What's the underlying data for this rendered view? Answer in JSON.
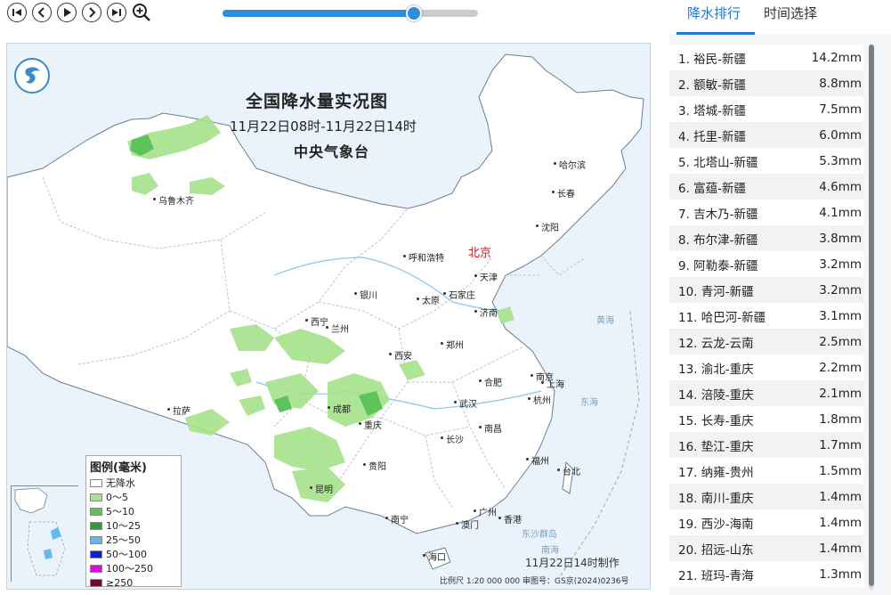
{
  "map": {
    "title": "全国降水量实况图",
    "subtitle": "11月22日08时-11月22日14时",
    "issuer": "中央气象台",
    "made_time": "11月22日14时制作",
    "footnote": "比例尺 1:20 000 000     审图号：GS京(2024)0236号",
    "capital": "北京",
    "cities": [
      {
        "name": "哈尔滨"
      },
      {
        "name": "长春"
      },
      {
        "name": "沈阳"
      },
      {
        "name": "乌鲁木齐"
      },
      {
        "name": "呼和浩特"
      },
      {
        "name": "天津"
      },
      {
        "name": "石家庄"
      },
      {
        "name": "太原"
      },
      {
        "name": "银川"
      },
      {
        "name": "济南"
      },
      {
        "name": "西宁"
      },
      {
        "name": "兰州"
      },
      {
        "name": "郑州"
      },
      {
        "name": "西安"
      },
      {
        "name": "南京"
      },
      {
        "name": "合肥"
      },
      {
        "name": "上海"
      },
      {
        "name": "杭州"
      },
      {
        "name": "武汉"
      },
      {
        "name": "成都"
      },
      {
        "name": "重庆"
      },
      {
        "name": "拉萨"
      },
      {
        "name": "南昌"
      },
      {
        "name": "长沙"
      },
      {
        "name": "福州"
      },
      {
        "name": "贵阳"
      },
      {
        "name": "台北"
      },
      {
        "name": "昆明"
      },
      {
        "name": "南宁"
      },
      {
        "name": "广州"
      },
      {
        "name": "香港"
      },
      {
        "name": "澳门"
      },
      {
        "name": "海口"
      }
    ],
    "seas": [
      {
        "name": "黄海"
      },
      {
        "name": "东海"
      },
      {
        "name": "南海"
      },
      {
        "name": "东沙群岛"
      }
    ],
    "legend": {
      "title": "图例(毫米)",
      "items": [
        {
          "label": "无降水",
          "color": "#ffffff"
        },
        {
          "label": "0～5",
          "color": "#a6e28a"
        },
        {
          "label": "5～10",
          "color": "#5cc45a"
        },
        {
          "label": "10～25",
          "color": "#2f9b3a"
        },
        {
          "label": "25～50",
          "color": "#62b8f0"
        },
        {
          "label": "50～100",
          "color": "#0a1fe0"
        },
        {
          "label": "100～250",
          "color": "#ea00ea"
        },
        {
          "label": "≥250",
          "color": "#7e0030"
        }
      ]
    }
  },
  "tabs": [
    {
      "label": "降水排行",
      "active": true
    },
    {
      "label": "时间选择",
      "active": false
    }
  ],
  "player": {
    "progress_fraction": 0.75
  },
  "ranking": [
    {
      "label": "1. 裕民-新疆",
      "value": "14.2mm"
    },
    {
      "label": "2. 额敏-新疆",
      "value": "8.8mm"
    },
    {
      "label": "3. 塔城-新疆",
      "value": "7.5mm"
    },
    {
      "label": "4. 托里-新疆",
      "value": "6.0mm"
    },
    {
      "label": "5. 北塔山-新疆",
      "value": "5.3mm"
    },
    {
      "label": "6. 富蕴-新疆",
      "value": "4.6mm"
    },
    {
      "label": "7. 吉木乃-新疆",
      "value": "4.1mm"
    },
    {
      "label": "8. 布尔津-新疆",
      "value": "3.8mm"
    },
    {
      "label": "9. 阿勒泰-新疆",
      "value": "3.2mm"
    },
    {
      "label": "10. 青河-新疆",
      "value": "3.2mm"
    },
    {
      "label": "11. 哈巴河-新疆",
      "value": "3.1mm"
    },
    {
      "label": "12. 云龙-云南",
      "value": "2.5mm"
    },
    {
      "label": "13. 渝北-重庆",
      "value": "2.2mm"
    },
    {
      "label": "14. 涪陵-重庆",
      "value": "2.1mm"
    },
    {
      "label": "15. 长寿-重庆",
      "value": "1.8mm"
    },
    {
      "label": "16. 垫江-重庆",
      "value": "1.7mm"
    },
    {
      "label": "17. 纳雍-贵州",
      "value": "1.5mm"
    },
    {
      "label": "18. 南川-重庆",
      "value": "1.4mm"
    },
    {
      "label": "19. 西沙-海南",
      "value": "1.4mm"
    },
    {
      "label": "20. 招远-山东",
      "value": "1.4mm"
    },
    {
      "label": "21. 班玛-青海",
      "value": "1.3mm"
    }
  ]
}
